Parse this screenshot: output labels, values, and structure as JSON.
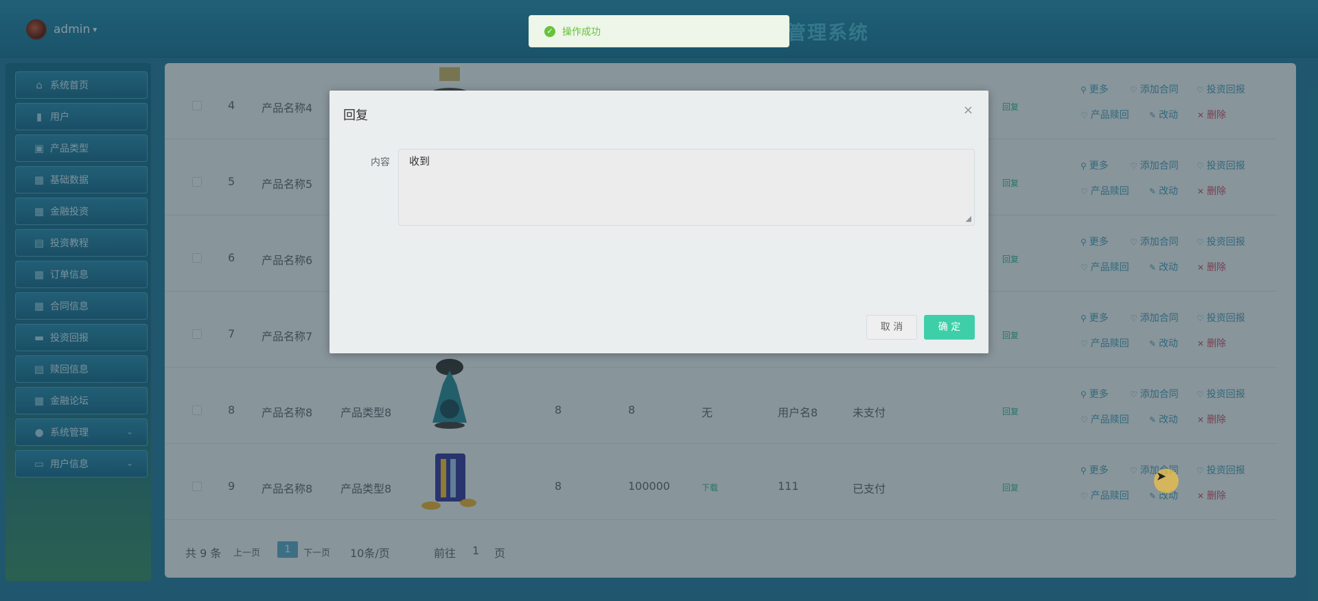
{
  "header": {
    "user": "admin",
    "title": "管理系统"
  },
  "sidebar": {
    "items": [
      {
        "label": "系统首页",
        "icon": "home-icon"
      },
      {
        "label": "用户",
        "icon": "chart-icon"
      },
      {
        "label": "产品类型",
        "icon": "clipboard-icon"
      },
      {
        "label": "基础数据",
        "icon": "grid-icon"
      },
      {
        "label": "金融投资",
        "icon": "grid9-icon"
      },
      {
        "label": "投资教程",
        "icon": "chat-icon"
      },
      {
        "label": "订单信息",
        "icon": "grid-icon"
      },
      {
        "label": "合同信息",
        "icon": "grid-icon"
      },
      {
        "label": "投资回报",
        "icon": "briefcase-icon"
      },
      {
        "label": "赎回信息",
        "icon": "document-icon"
      },
      {
        "label": "金融论坛",
        "icon": "grid-icon"
      },
      {
        "label": "系统管理",
        "icon": "user-icon"
      },
      {
        "label": "用户信息",
        "icon": "card-icon"
      }
    ]
  },
  "table": {
    "rows": [
      {
        "idx": "4",
        "name": "产品名称4",
        "type": "",
        "a": "",
        "b": "",
        "c": "",
        "user": "",
        "pay": "",
        "tag": "回复"
      },
      {
        "idx": "5",
        "name": "产品名称5",
        "type": "",
        "a": "",
        "b": "",
        "c": "",
        "user": "",
        "pay": "",
        "tag": "回复"
      },
      {
        "idx": "6",
        "name": "产品名称6",
        "type": "",
        "a": "",
        "b": "",
        "c": "",
        "user": "",
        "pay": "",
        "tag": "回复"
      },
      {
        "idx": "7",
        "name": "产品名称7",
        "type": "",
        "a": "",
        "b": "",
        "c": "",
        "user": "",
        "pay": "",
        "tag": "回复"
      },
      {
        "idx": "8",
        "name": "产品名称8",
        "type": "产品类型8",
        "a": "8",
        "b": "8",
        "c": "无",
        "user": "用户名8",
        "pay": "未支付",
        "tag": "回复"
      },
      {
        "idx": "9",
        "name": "产品名称8",
        "type": "产品类型8",
        "a": "8",
        "b": "100000",
        "c": "下载",
        "user": "111",
        "pay": "已支付",
        "tag": "回复"
      }
    ],
    "actions": {
      "more": "更多",
      "add_contract": "添加合同",
      "investment_return": "投资回报",
      "redeem": "产品赎回",
      "edit": "改动",
      "delete": "删除"
    }
  },
  "pager": {
    "total": "共 9 条",
    "prev": "上一页",
    "page": "1",
    "next": "下一页",
    "size": "10条/页",
    "goto": "前往",
    "goto_page": "1",
    "page_unit": "页"
  },
  "dialog": {
    "title": "回复",
    "close": "×",
    "content_label": "内容",
    "content_value": "收到",
    "cancel": "取 消",
    "confirm": "确 定"
  },
  "toast": {
    "text": "操作成功"
  }
}
